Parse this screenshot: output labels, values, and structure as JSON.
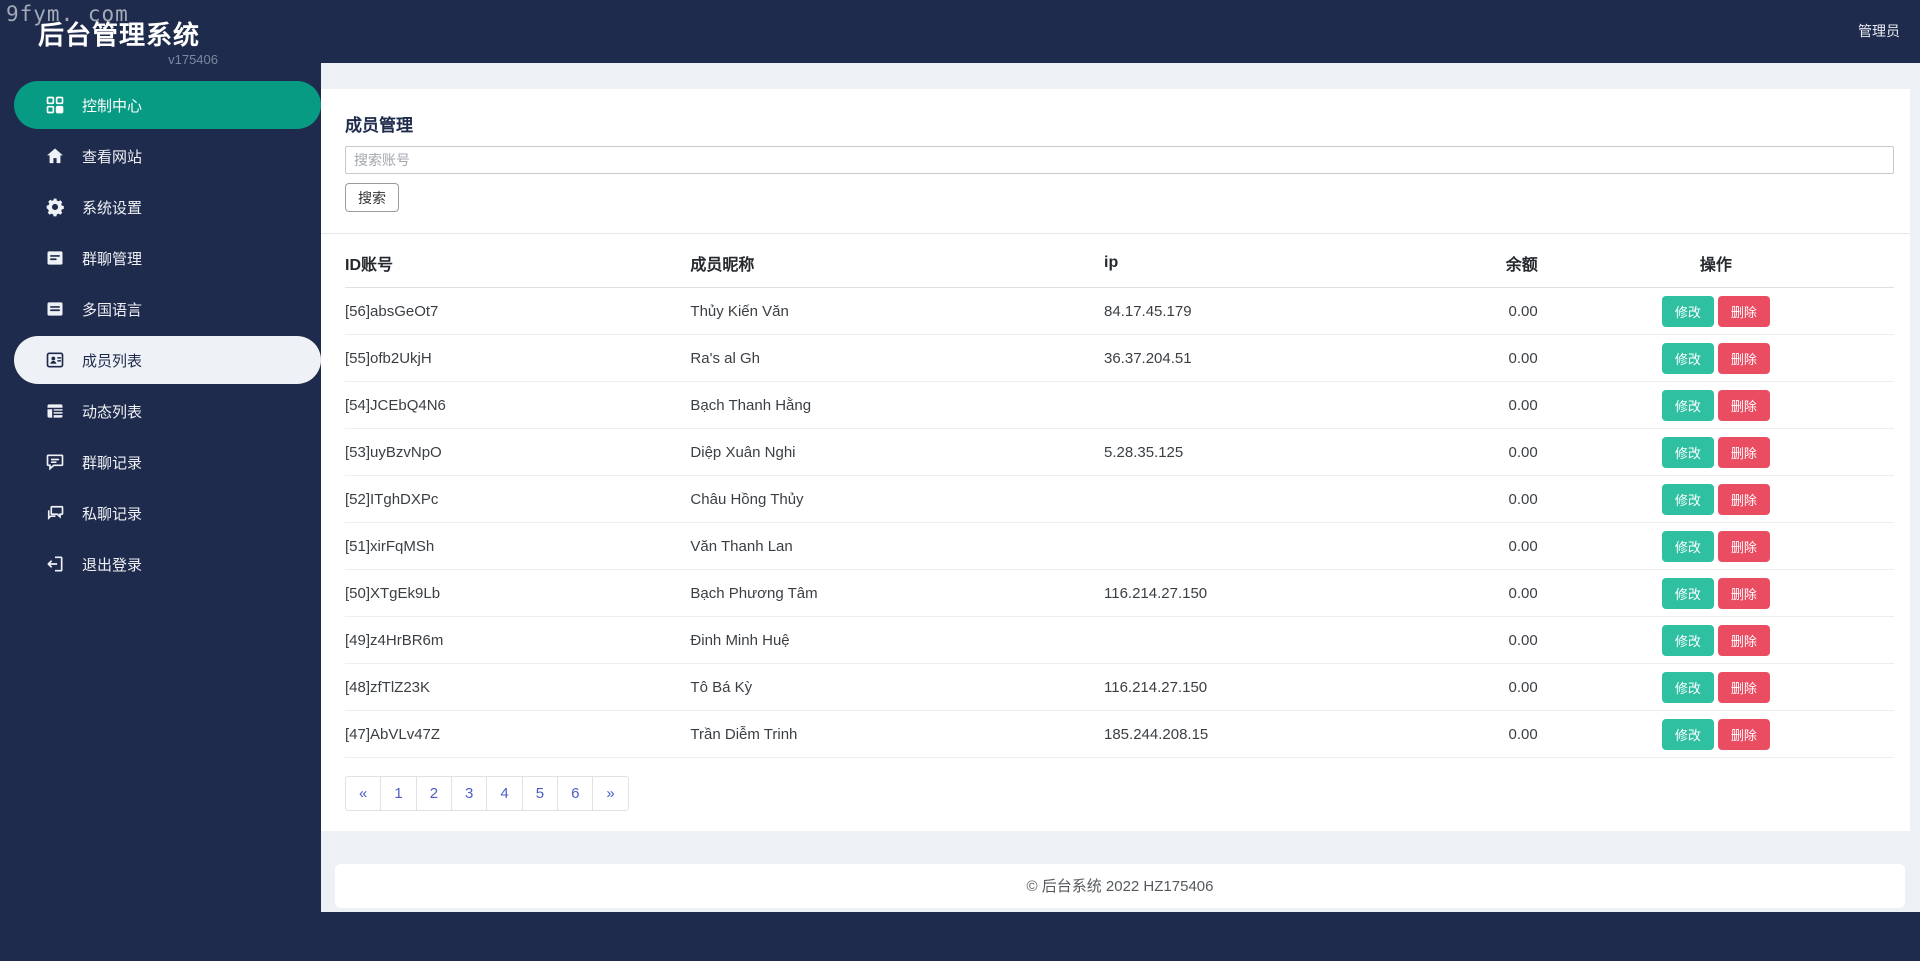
{
  "watermark": "9fym. com",
  "app": {
    "title": "后台管理系统",
    "version": "v175406"
  },
  "topbar": {
    "user": "管理员"
  },
  "sidebar": {
    "items": [
      {
        "label": "控制中心",
        "icon": "dashboard-icon",
        "state": "active-primary"
      },
      {
        "label": "查看网站",
        "icon": "home-icon",
        "state": "normal"
      },
      {
        "label": "系统设置",
        "icon": "gear-icon",
        "state": "normal"
      },
      {
        "label": "群聊管理",
        "icon": "group-chat-manage-icon",
        "state": "normal"
      },
      {
        "label": "多国语言",
        "icon": "language-icon",
        "state": "normal"
      },
      {
        "label": "成员列表",
        "icon": "member-list-icon",
        "state": "active-light"
      },
      {
        "label": "动态列表",
        "icon": "activity-list-icon",
        "state": "normal"
      },
      {
        "label": "群聊记录",
        "icon": "group-chat-log-icon",
        "state": "normal"
      },
      {
        "label": "私聊记录",
        "icon": "private-chat-log-icon",
        "state": "normal"
      },
      {
        "label": "退出登录",
        "icon": "logout-icon",
        "state": "normal"
      }
    ]
  },
  "main": {
    "title": "成员管理",
    "search": {
      "placeholder": "搜索账号",
      "value": "",
      "button_label": "搜索"
    },
    "table": {
      "headers": [
        "ID账号",
        "成员昵称",
        "ip",
        "余额",
        "操作"
      ],
      "edit_label": "修改",
      "delete_label": "删除",
      "rows": [
        {
          "id": "[56]absGeOt7",
          "name": "Thủy Kiến Văn",
          "ip": "84.17.45.179",
          "balance": "0.00"
        },
        {
          "id": "[55]ofb2UkjH",
          "name": "Ra's al Gh",
          "ip": "36.37.204.51",
          "balance": "0.00"
        },
        {
          "id": "[54]JCEbQ4N6",
          "name": "Bạch Thanh Hằng",
          "ip": "",
          "balance": "0.00"
        },
        {
          "id": "[53]uyBzvNpO",
          "name": "Diệp Xuân Nghi",
          "ip": "5.28.35.125",
          "balance": "0.00"
        },
        {
          "id": "[52]ITghDXPc",
          "name": "Châu Hồng Thủy",
          "ip": "",
          "balance": "0.00"
        },
        {
          "id": "[51]xirFqMSh",
          "name": "Văn Thanh Lan",
          "ip": "",
          "balance": "0.00"
        },
        {
          "id": "[50]XTgEk9Lb",
          "name": "Bạch Phương Tâm",
          "ip": "116.214.27.150",
          "balance": "0.00"
        },
        {
          "id": "[49]z4HrBR6m",
          "name": "Đinh Minh Huệ",
          "ip": "",
          "balance": "0.00"
        },
        {
          "id": "[48]zfTlZ23K",
          "name": "Tô Bá Kỳ",
          "ip": "116.214.27.150",
          "balance": "0.00"
        },
        {
          "id": "[47]AbVLv47Z",
          "name": "Trần Diễm Trinh",
          "ip": "185.244.208.15",
          "balance": "0.00"
        }
      ]
    },
    "pagination": {
      "items": [
        "«",
        "1",
        "2",
        "3",
        "4",
        "5",
        "6",
        "»"
      ]
    }
  },
  "footer": {
    "text": "© 后台系统 2022 HZ175406"
  },
  "colors": {
    "navy": "#1f2b4c",
    "teal_active": "#089b84",
    "content_bg": "#edf0f5",
    "edit_button": "#2fc0a2",
    "delete_button": "#ea4c62",
    "pagination_link": "#4c5ec5"
  }
}
